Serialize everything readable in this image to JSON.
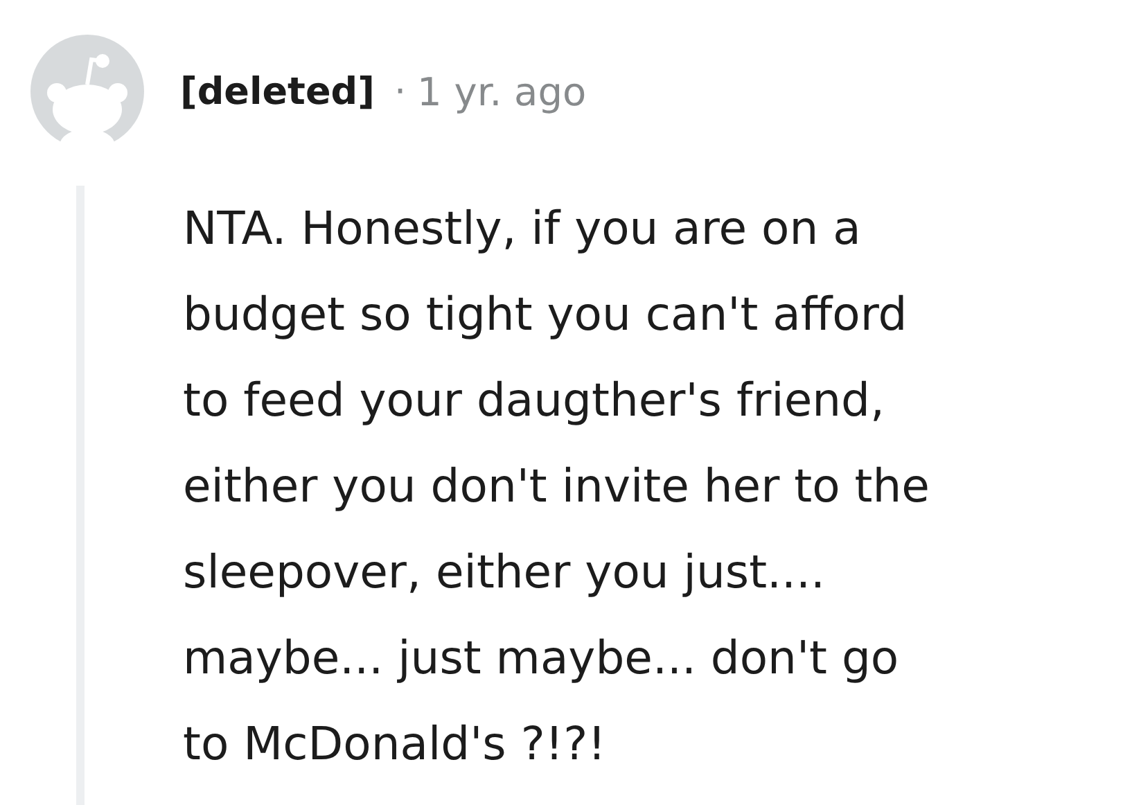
{
  "comment": {
    "author": "[deleted]",
    "separator": "·",
    "age": "1 yr. ago",
    "body_lines": [
      "NTA. Honestly, if you are on a",
      "budget so tight you can't afford",
      "to feed your daugther's friend,",
      "either you don't invite her to the",
      "sleepover, either you just....",
      "maybe... just maybe... don't go",
      "to McDonald's ?!?!"
    ]
  }
}
